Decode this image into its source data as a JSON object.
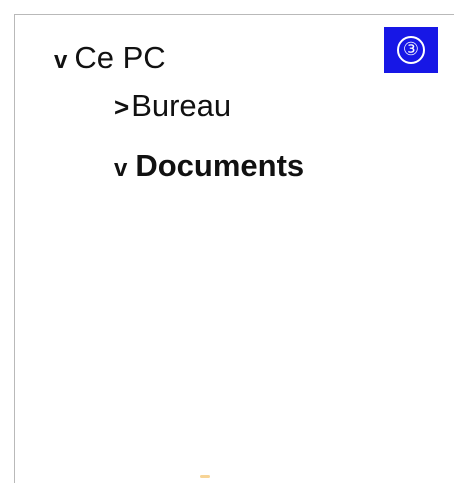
{
  "tree": {
    "items": [
      {
        "label": "Ce PC",
        "state": "expanded",
        "expander_glyph": "v"
      },
      {
        "label": "Bureau",
        "state": "collapsed",
        "expander_glyph": ">"
      },
      {
        "label": "Documents",
        "state": "expanded",
        "expander_glyph": "v"
      }
    ]
  },
  "badge": {
    "label": "③",
    "color": "#1717e6"
  },
  "icons": {
    "expanded": "chevron-down-icon",
    "collapsed": "chevron-right-icon"
  }
}
